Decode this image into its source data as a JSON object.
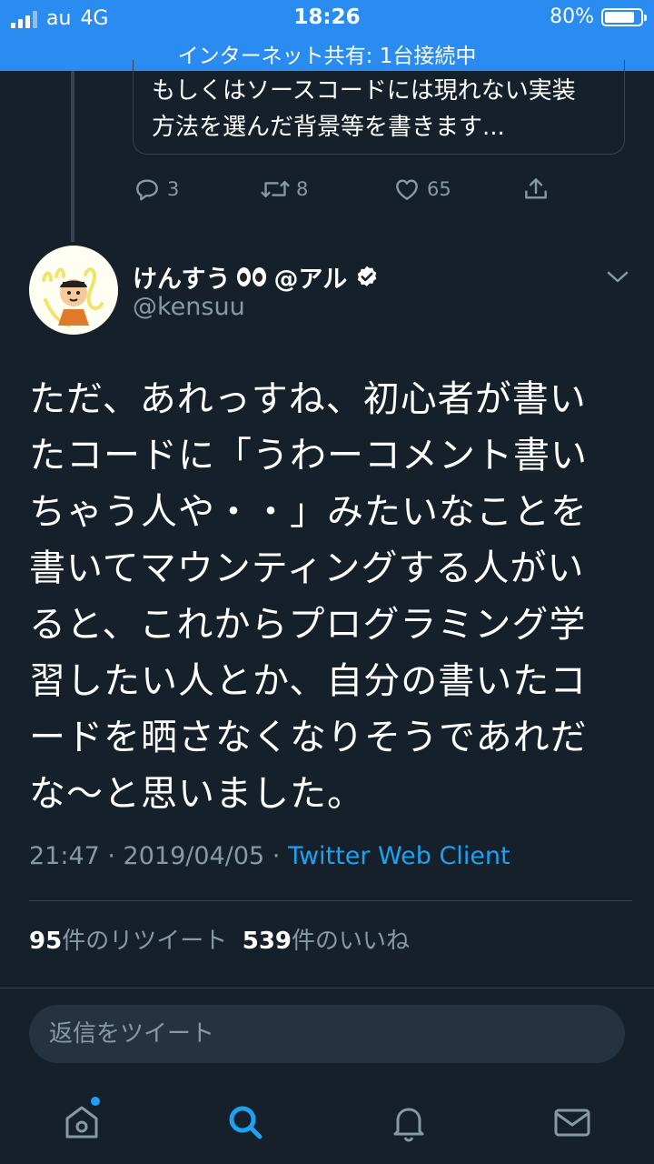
{
  "status_bar": {
    "carrier": "au",
    "network": "4G",
    "time": "18:26",
    "battery": "80%",
    "hotspot": "インターネット共有: 1台接続中"
  },
  "previous_tweet": {
    "text_line1": "もしくはソースコードには現れない実装",
    "text_line2": "方法を選んだ背景等を書きます...",
    "replies": "3",
    "retweets": "8",
    "likes": "65"
  },
  "tweet": {
    "name_prefix": "けんすう",
    "name_suffix": "@アル",
    "handle": "@kensuu",
    "lines": [
      "ただ、あれっすね、初心者が書い",
      "たコードに「うわーコメント書い",
      "ちゃう人や・・」みたいなことを",
      "書いてマウンティングする人がい",
      "ると、これからプログラミング学",
      "習したい人とか、自分の書いたコ",
      "ードを晒さなくなりそうであれだ",
      "な〜と思いました。"
    ],
    "timestamp": "21:47 · 2019/04/05 · ",
    "client": "Twitter Web Client",
    "retweet_count": "95",
    "retweet_label": "件のリツイート",
    "like_count": "539",
    "like_label": "件のいいね"
  },
  "reply_box": {
    "placeholder": "返信をツイート"
  },
  "tab_bar": {
    "icons": [
      "home-icon",
      "search-icon",
      "notifications-icon",
      "messages-icon"
    ]
  },
  "colors": {
    "background": "#15202b",
    "accent": "#1da1f2",
    "status_bar": "#2a8cf0",
    "secondary_text": "#8899a6"
  }
}
